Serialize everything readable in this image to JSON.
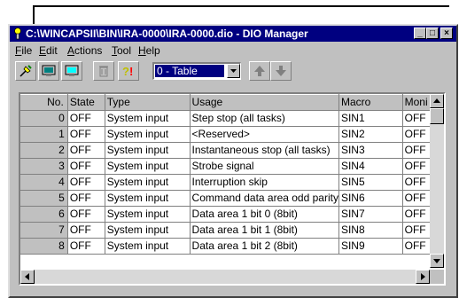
{
  "window": {
    "title": "C:\\WINCAPSII\\BIN\\IRA-0000\\IRA-0000.dio - DIO Manager",
    "controls": [
      "_",
      "□",
      "×"
    ]
  },
  "menu": [
    {
      "label": "File",
      "key": "F"
    },
    {
      "label": "Edit",
      "key": "E"
    },
    {
      "label": "Actions",
      "key": "A"
    },
    {
      "label": "Tool",
      "key": "T"
    },
    {
      "label": "Help",
      "key": "H"
    }
  ],
  "toolbar": {
    "view_select": "0 - Table",
    "icons": [
      "pin-icon",
      "monitor-icon",
      "monitor-active-icon",
      "trash-icon",
      "alert-icon",
      "up-arrow-icon",
      "down-arrow-icon"
    ]
  },
  "table": {
    "columns": [
      "No.",
      "State",
      "Type",
      "Usage",
      "Macro",
      "Moni"
    ],
    "rows": [
      {
        "no": "0",
        "state": "OFF",
        "type": "System input",
        "usage": "Step stop (all tasks)",
        "macro": "SIN1",
        "moni": "OFF"
      },
      {
        "no": "1",
        "state": "OFF",
        "type": "System input",
        "usage": "<Reserved>",
        "macro": "SIN2",
        "moni": "OFF"
      },
      {
        "no": "2",
        "state": "OFF",
        "type": "System input",
        "usage": "Instantaneous stop (all tasks)",
        "macro": "SIN3",
        "moni": "OFF"
      },
      {
        "no": "3",
        "state": "OFF",
        "type": "System input",
        "usage": "Strobe signal",
        "macro": "SIN4",
        "moni": "OFF"
      },
      {
        "no": "4",
        "state": "OFF",
        "type": "System input",
        "usage": "Interruption skip",
        "macro": "SIN5",
        "moni": "OFF"
      },
      {
        "no": "5",
        "state": "OFF",
        "type": "System input",
        "usage": "Command data area odd parity",
        "macro": "SIN6",
        "moni": "OFF"
      },
      {
        "no": "6",
        "state": "OFF",
        "type": "System input",
        "usage": "Data area 1 bit 0 (8bit)",
        "macro": "SIN7",
        "moni": "OFF"
      },
      {
        "no": "7",
        "state": "OFF",
        "type": "System input",
        "usage": "Data area 1 bit 1 (8bit)",
        "macro": "SIN8",
        "moni": "OFF"
      },
      {
        "no": "8",
        "state": "OFF",
        "type": "System input",
        "usage": "Data area 1 bit 2 (8bit)",
        "macro": "SIN9",
        "moni": "OFF"
      }
    ]
  },
  "colors": {
    "titlebar": "#000080",
    "face": "#c0c0c0"
  }
}
